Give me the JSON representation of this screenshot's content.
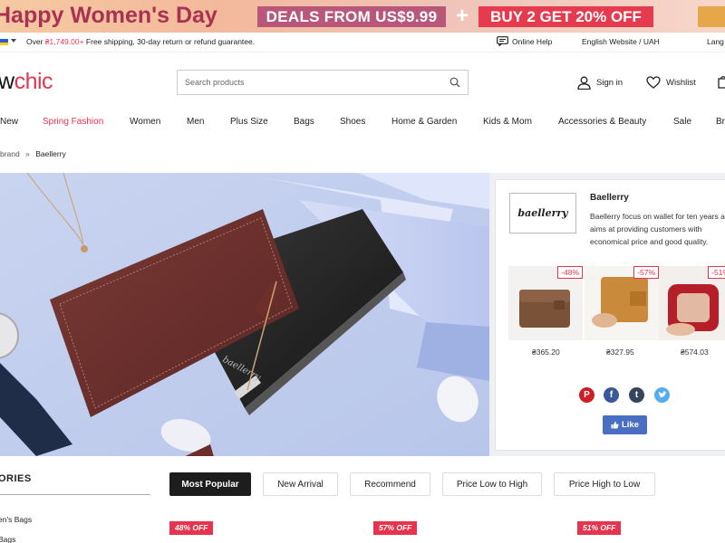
{
  "promo": {
    "title": "Happy Women's Day",
    "deal": "DEALS FROM US$9.99",
    "plus": "+",
    "offer": "BUY 2 GET 20% OFF"
  },
  "utility": {
    "shipping_prefix": "Over ",
    "shipping_amount": "₴1,749.00+",
    "shipping_suffix": " Free shipping, 30-day return or refund guarantee.",
    "online_help": "Online Help",
    "language": "English Website / UAH",
    "language_more": "Lang"
  },
  "header": {
    "logo_left": "w",
    "logo_right": "chic",
    "search_placeholder": "Search products",
    "sign_in": "Sign in",
    "wishlist": "Wishlist"
  },
  "nav": {
    "items": [
      "New",
      "Spring Fashion",
      "Women",
      "Men",
      "Plus Size",
      "Bags",
      "Shoes",
      "Home & Garden",
      "Kids & Mom",
      "Accessories & Beauty",
      "Sale",
      "Br"
    ]
  },
  "breadcrumb": {
    "parent": "brand",
    "separator": "»",
    "current": "Baellerry"
  },
  "brand": {
    "logo_text": "baellerry",
    "name": "Baellerry",
    "description": "Baellerry focus on wallet for ten years and aims at providing customers with economical price and good quality.",
    "products": [
      {
        "discount": "-48%",
        "price": "₴365.20"
      },
      {
        "discount": "-57%",
        "price": "₴327.95"
      },
      {
        "discount": "-51%",
        "price": "₴574.03"
      }
    ],
    "like_label": "Like"
  },
  "hero": {
    "wallet_brand": "baellerry"
  },
  "categories": {
    "title": "ORIES",
    "items": [
      "en's Bags",
      "Bags"
    ]
  },
  "sort": {
    "options": [
      "Most Popular",
      "New Arrival",
      "Recommend",
      "Price Low to High",
      "Price High to Low"
    ],
    "active": "Most Popular"
  },
  "badges": [
    "48% OFF",
    "57% OFF",
    "51% OFF"
  ],
  "colors": {
    "accent": "#e6344e",
    "promo_title": "#a93252",
    "deal_bg": "#b9577a",
    "offer_bg": "#e63b4f",
    "hero_bg": "#c7d2ef",
    "facebook": "#3b5998",
    "twitter": "#55acee",
    "pinterest": "#cb2027",
    "tumblr": "#35465c"
  }
}
